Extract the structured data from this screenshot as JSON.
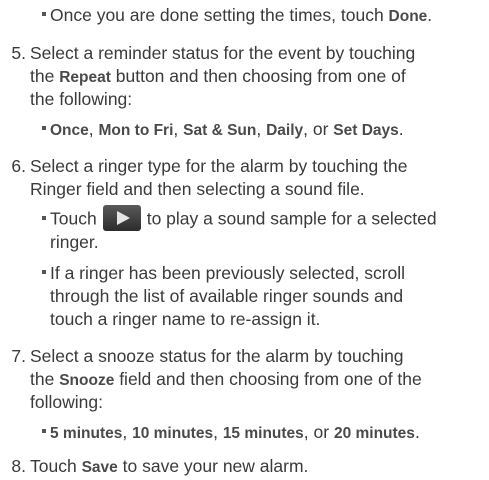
{
  "b0": {
    "pre": "Once you are done setting the times, touch ",
    "done": "Done",
    "post": "."
  },
  "s5": {
    "num": "5.",
    "l1": "Select a reminder status for the event by touching",
    "l2a": "the ",
    "repeat": "Repeat",
    "l2b": " button and then choosing from one of",
    "l3": "the following:"
  },
  "b5": {
    "once": "Once",
    "c1": ", ",
    "monfri": "Mon to Fri",
    "c2": ", ",
    "satsun": "Sat & Sun",
    "c3": ", ",
    "daily": "Daily",
    "c4": ", or ",
    "setdays": "Set Days",
    "end": "."
  },
  "s6": {
    "num": "6.",
    "l1": "Select a ringer type for the alarm by touching the",
    "l2": "Ringer field and then selecting a sound file."
  },
  "b6a": {
    "touch": "Touch",
    "l1b": "to play a sound sample for a selected",
    "l2": "ringer."
  },
  "b6b": {
    "l1": "If a ringer has been previously selected, scroll",
    "l2": "through the list of available ringer sounds and",
    "l3": "touch a ringer name to re-assign it."
  },
  "s7": {
    "num": "7.",
    "l1": "Select a snooze status for the alarm by touching",
    "l2a": "the ",
    "snooze": "Snooze",
    "l2b": " field and then choosing from one of the",
    "l3": "following:"
  },
  "b7": {
    "m5": "5 minutes",
    "c1": ", ",
    "m10": "10 minutes",
    "c2": ", ",
    "m15": "15 minutes",
    "c3": ", or ",
    "m20": "20 minutes",
    "end": "."
  },
  "s8": {
    "num": "8.",
    "pre": "Touch ",
    "save": "Save",
    "post": " to save your new alarm."
  }
}
